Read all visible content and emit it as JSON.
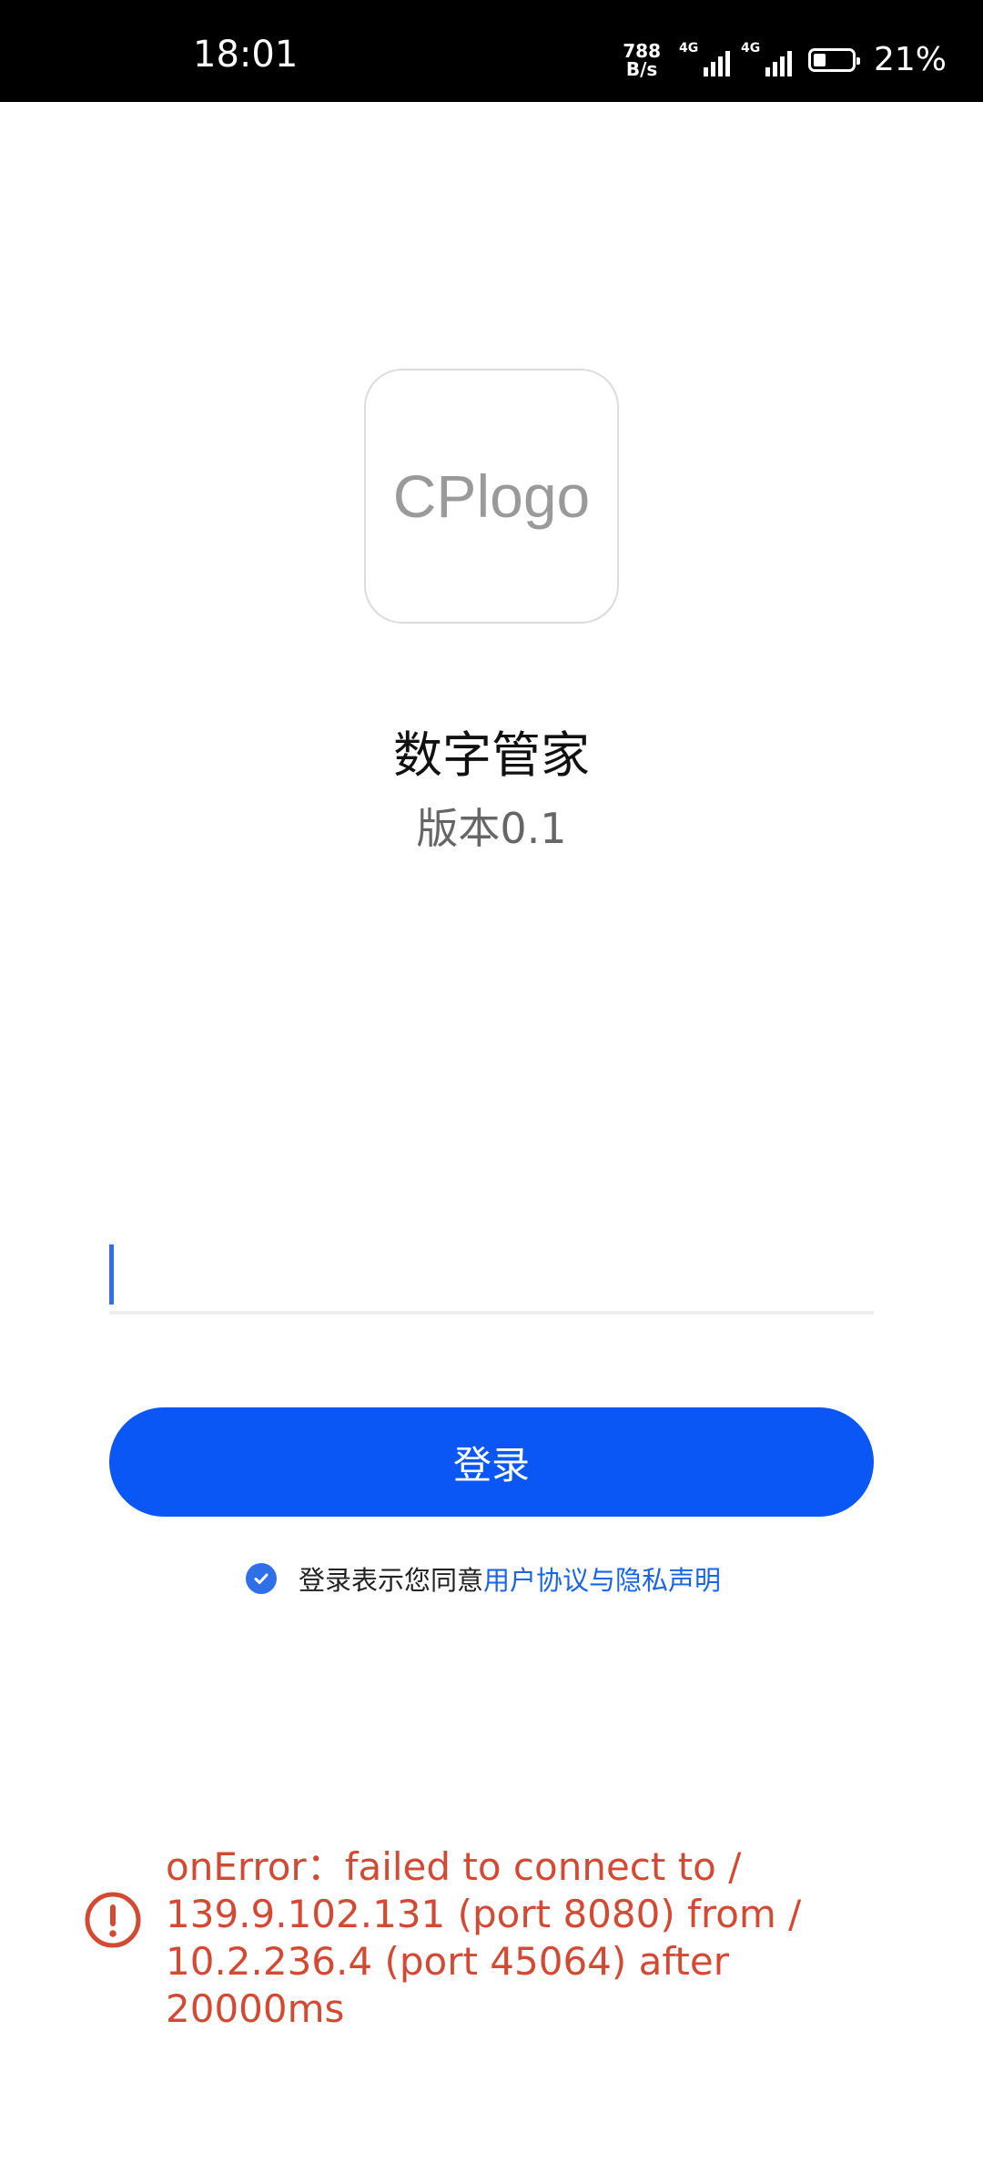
{
  "status_bar": {
    "time": "18:01",
    "net_speed_value": "788",
    "net_speed_unit": "B/s",
    "sim1_label": "4G",
    "sim2_label": "4G",
    "battery_percent": "21%",
    "battery_level": 0.21
  },
  "logo": {
    "text": "CPlogo"
  },
  "app": {
    "name": "数字管家",
    "version": "版本0.1"
  },
  "login": {
    "input_value": "",
    "input_placeholder": "",
    "button_label": "登录"
  },
  "agreement": {
    "checked": true,
    "prefix": "登录表示您同意",
    "link": "用户协议与隐私声明"
  },
  "error": {
    "message": "onError：failed to connect to /\n139.9.102.131 (port 8080) from /\n10.2.236.4 (port 45064) after 20000ms"
  },
  "colors": {
    "primary": "#0b57f5",
    "link": "#1a64e8",
    "error": "#d24a33",
    "status_bar_bg": "#000000"
  }
}
